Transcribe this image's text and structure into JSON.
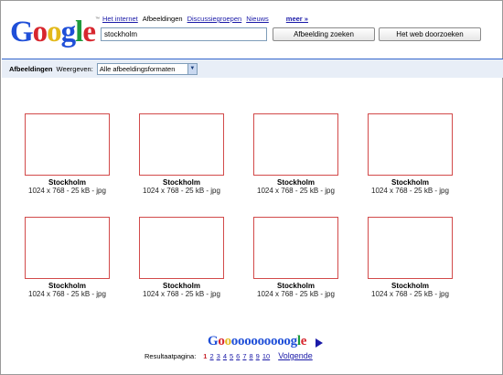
{
  "logo": {
    "letters": [
      {
        "ch": "G",
        "color": "#1f4fd8"
      },
      {
        "ch": "o",
        "color": "#d7262e"
      },
      {
        "ch": "o",
        "color": "#e3b91b"
      },
      {
        "ch": "g",
        "color": "#1f4fd8"
      },
      {
        "ch": "l",
        "color": "#1d9a3c"
      },
      {
        "ch": "e",
        "color": "#d7262e"
      }
    ],
    "tm": "™"
  },
  "nav": {
    "items": [
      {
        "label": "Het internet",
        "active": false
      },
      {
        "label": "Afbeeldingen",
        "active": true
      },
      {
        "label": "Discussiegroepen",
        "active": false
      },
      {
        "label": "Nieuws",
        "active": false
      }
    ],
    "more": "meer »"
  },
  "search": {
    "query": "stockholm",
    "images_button": "Afbeelding zoeken",
    "web_button": "Het web doorzoeken"
  },
  "toolbar": {
    "title": "Afbeeldingen",
    "view_label": "Weergeven:",
    "format_value": "Alle afbeeldingsformaten",
    "accent": "#3366cc"
  },
  "results": [
    {
      "name": "Stockholm",
      "meta": "1024 x 768 - 25 kB - jpg"
    },
    {
      "name": "Stockholm",
      "meta": "1024 x 768 - 25 kB - jpg"
    },
    {
      "name": "Stockholm",
      "meta": "1024 x 768 - 25 kB - jpg"
    },
    {
      "name": "Stockholm",
      "meta": "1024 x 768 - 25 kB - jpg"
    },
    {
      "name": "Stockholm",
      "meta": "1024 x 768 - 25 kB - jpg"
    },
    {
      "name": "Stockholm",
      "meta": "1024 x 768 - 25 kB - jpg"
    },
    {
      "name": "Stockholm",
      "meta": "1024 x 768 - 25 kB - jpg"
    },
    {
      "name": "Stockholm",
      "meta": "1024 x 768 - 25 kB - jpg"
    }
  ],
  "pagination": {
    "label": "Resultaatpagina:",
    "pages": [
      "1",
      "2",
      "3",
      "4",
      "5",
      "6",
      "7",
      "8",
      "9",
      "10"
    ],
    "current": "1",
    "next": "Volgende",
    "goo_letters": [
      {
        "ch": "G",
        "color": "#1f4fd8"
      },
      {
        "ch": "o",
        "color": "#d7262e"
      },
      {
        "ch": "o",
        "color": "#e3b91b"
      },
      {
        "ch": "o",
        "color": "#1f4fd8"
      },
      {
        "ch": "o",
        "color": "#1f4fd8"
      },
      {
        "ch": "o",
        "color": "#1f4fd8"
      },
      {
        "ch": "o",
        "color": "#1f4fd8"
      },
      {
        "ch": "o",
        "color": "#1f4fd8"
      },
      {
        "ch": "o",
        "color": "#1f4fd8"
      },
      {
        "ch": "o",
        "color": "#1f4fd8"
      },
      {
        "ch": "o",
        "color": "#1f4fd8"
      },
      {
        "ch": "o",
        "color": "#1f4fd8"
      },
      {
        "ch": "g",
        "color": "#1f4fd8"
      },
      {
        "ch": "l",
        "color": "#1d9a3c"
      },
      {
        "ch": "e",
        "color": "#d7262e"
      }
    ]
  }
}
